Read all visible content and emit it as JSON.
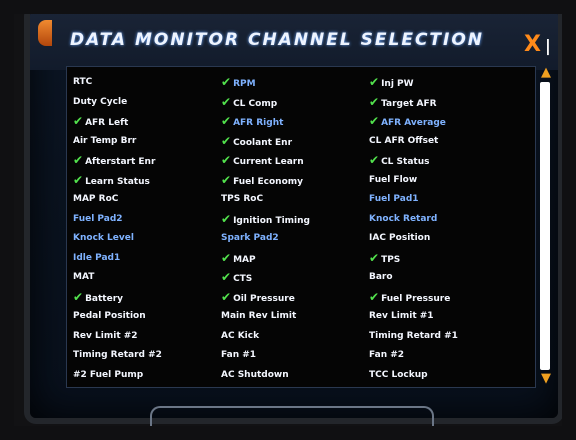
{
  "window": {
    "title": "DATA MONITOR CHANNEL SELECTION",
    "close_label": "X",
    "close_bar": "|"
  },
  "colors": {
    "white_text": "#f4f7ff",
    "blue_text": "#7fb2ff",
    "check": "#52e24d",
    "accent": "#ff8a1a"
  },
  "channels": [
    [
      {
        "label": "RTC",
        "checked": false,
        "color": "white"
      },
      {
        "label": "Duty Cycle",
        "checked": false,
        "color": "white"
      },
      {
        "label": "AFR Left",
        "checked": true,
        "color": "white"
      },
      {
        "label": "Air Temp Brr",
        "checked": false,
        "color": "white"
      },
      {
        "label": "Afterstart Enr",
        "checked": true,
        "color": "white"
      },
      {
        "label": "Learn Status",
        "checked": true,
        "color": "white"
      },
      {
        "label": "MAP RoC",
        "checked": false,
        "color": "white"
      },
      {
        "label": "Fuel Pad2",
        "checked": false,
        "color": "blue"
      },
      {
        "label": "Knock Level",
        "checked": false,
        "color": "blue"
      },
      {
        "label": "Idle Pad1",
        "checked": false,
        "color": "blue"
      },
      {
        "label": "MAT",
        "checked": false,
        "color": "white"
      },
      {
        "label": "Battery",
        "checked": true,
        "color": "white"
      },
      {
        "label": "Pedal Position",
        "checked": false,
        "color": "white"
      },
      {
        "label": "Rev Limit #2",
        "checked": false,
        "color": "white"
      },
      {
        "label": "Timing Retard #2",
        "checked": false,
        "color": "white"
      },
      {
        "label": "#2 Fuel Pump",
        "checked": false,
        "color": "white"
      }
    ],
    [
      {
        "label": "RPM",
        "checked": true,
        "color": "blue"
      },
      {
        "label": "CL Comp",
        "checked": true,
        "color": "white"
      },
      {
        "label": "AFR Right",
        "checked": true,
        "color": "blue"
      },
      {
        "label": "Coolant Enr",
        "checked": true,
        "color": "white"
      },
      {
        "label": "Current Learn",
        "checked": true,
        "color": "white"
      },
      {
        "label": "Fuel Economy",
        "checked": true,
        "color": "white"
      },
      {
        "label": "TPS RoC",
        "checked": false,
        "color": "white"
      },
      {
        "label": "Ignition Timing",
        "checked": true,
        "color": "white"
      },
      {
        "label": "Spark Pad2",
        "checked": false,
        "color": "blue"
      },
      {
        "label": "MAP",
        "checked": true,
        "color": "white"
      },
      {
        "label": "CTS",
        "checked": true,
        "color": "white"
      },
      {
        "label": "Oil Pressure",
        "checked": true,
        "color": "white"
      },
      {
        "label": "Main Rev Limit",
        "checked": false,
        "color": "white"
      },
      {
        "label": "AC Kick",
        "checked": false,
        "color": "white"
      },
      {
        "label": "Fan #1",
        "checked": false,
        "color": "white"
      },
      {
        "label": "AC Shutdown",
        "checked": false,
        "color": "white"
      }
    ],
    [
      {
        "label": "Inj PW",
        "checked": true,
        "color": "white"
      },
      {
        "label": "Target AFR",
        "checked": true,
        "color": "white"
      },
      {
        "label": "AFR Average",
        "checked": true,
        "color": "blue"
      },
      {
        "label": "CL AFR Offset",
        "checked": false,
        "color": "white"
      },
      {
        "label": "CL Status",
        "checked": true,
        "color": "white"
      },
      {
        "label": "Fuel Flow",
        "checked": false,
        "color": "white"
      },
      {
        "label": "Fuel Pad1",
        "checked": false,
        "color": "blue"
      },
      {
        "label": "Knock Retard",
        "checked": false,
        "color": "blue"
      },
      {
        "label": "IAC Position",
        "checked": false,
        "color": "white"
      },
      {
        "label": "TPS",
        "checked": true,
        "color": "white"
      },
      {
        "label": "Baro",
        "checked": false,
        "color": "white"
      },
      {
        "label": "Fuel Pressure",
        "checked": true,
        "color": "white"
      },
      {
        "label": "Rev Limit #1",
        "checked": false,
        "color": "white"
      },
      {
        "label": "Timing Retard #1",
        "checked": false,
        "color": "white"
      },
      {
        "label": "Fan #2",
        "checked": false,
        "color": "white"
      },
      {
        "label": "TCC Lockup",
        "checked": false,
        "color": "white"
      }
    ]
  ],
  "scrollbar": {
    "up_icon": "scroll-up-arrow-icon",
    "down_icon": "scroll-down-arrow-icon",
    "up_glyph": "▲",
    "down_glyph": "▼",
    "check_glyph": "✔"
  }
}
